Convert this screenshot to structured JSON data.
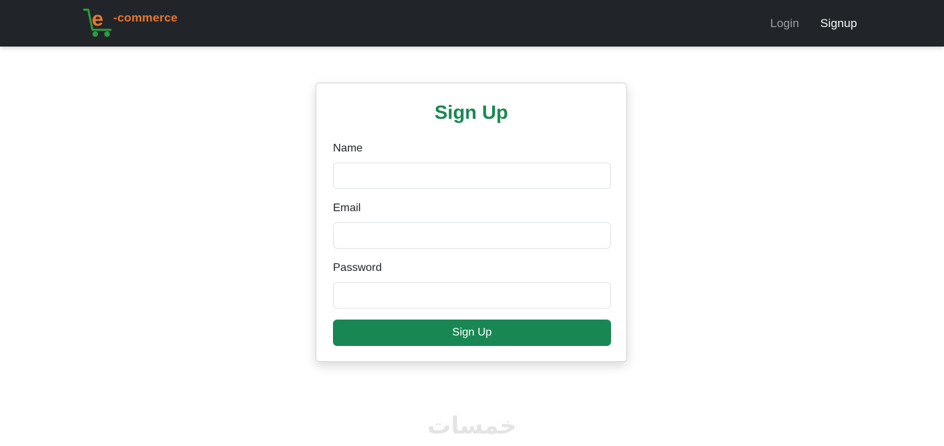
{
  "nav": {
    "brand_text": "-commerce",
    "brand_letter": "e",
    "links": [
      "Login",
      "Signup"
    ]
  },
  "form": {
    "title": "Sign Up",
    "fields": [
      {
        "label": "Name",
        "value": "",
        "placeholder": ""
      },
      {
        "label": "Email",
        "value": "",
        "placeholder": ""
      },
      {
        "label": "Password",
        "value": "",
        "placeholder": ""
      }
    ],
    "submit_label": "Sign Up"
  },
  "watermark": {
    "text": "خمسات"
  },
  "colors": {
    "navbar_bg": "#212529",
    "brand_orange": "#e8762d",
    "brand_green": "#2e9b3f",
    "accent_green": "#198754"
  }
}
